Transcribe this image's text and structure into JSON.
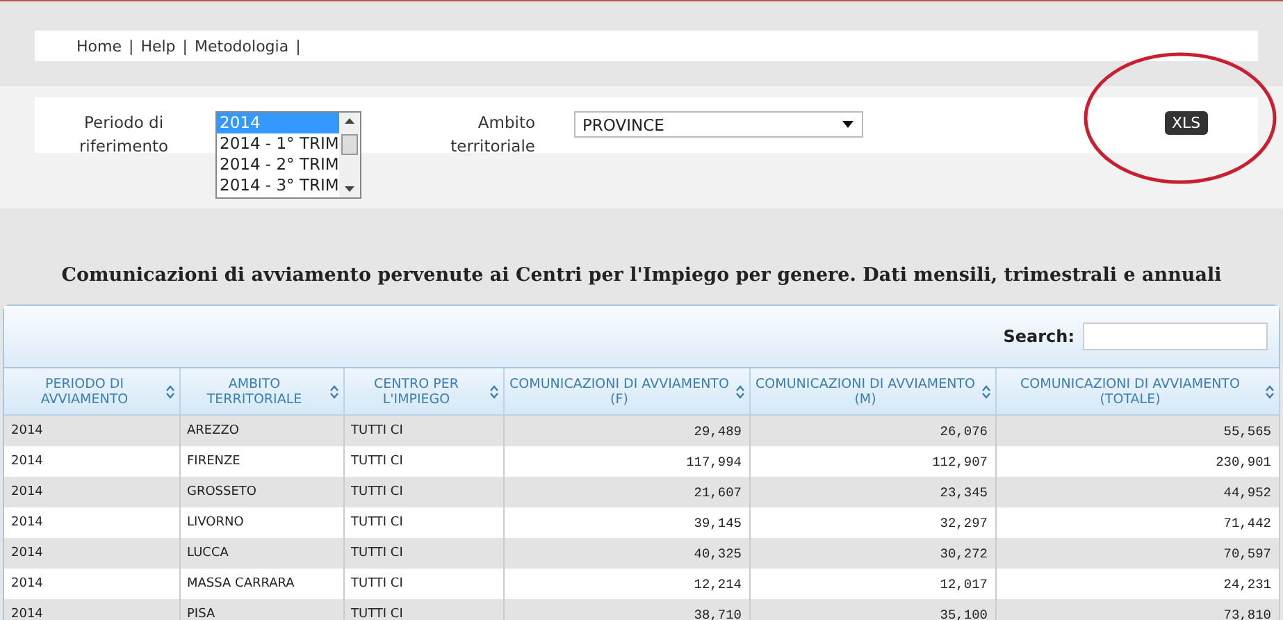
{
  "nav_links": [
    "Home",
    "Help",
    "Metodologia"
  ],
  "nav_separator": "|",
  "filters": {
    "period_label": "Periodo di riferimento",
    "period_options": [
      {
        "label": "2014",
        "selected": true
      },
      {
        "label": "2014 - 1° TRIM",
        "selected": false
      },
      {
        "label": "2014 - 2° TRIM",
        "selected": false
      },
      {
        "label": "2014 - 3° TRIM",
        "selected": false
      }
    ],
    "scope_label": "Ambito territoriale",
    "scope_value": "PROVINCE",
    "export_button": "XLS"
  },
  "title": "Comunicazioni di avviamento pervenute ai Centri per l'Impiego per genere. Dati mensili, trimestrali e annuali",
  "table": {
    "search_label": "Search:",
    "columns": [
      {
        "label": "PERIODO DI AVVIAMENTO",
        "kind": "text"
      },
      {
        "label": "AMBITO TERRITORIALE",
        "kind": "text"
      },
      {
        "label": "CENTRO PER L'IMPIEGO",
        "kind": "text"
      },
      {
        "label": "COMUNICAZIONI DI AVVIAMENTO (F)",
        "kind": "number"
      },
      {
        "label": "COMUNICAZIONI DI AVVIAMENTO (M)",
        "kind": "number"
      },
      {
        "label": "COMUNICAZIONI DI AVVIAMENTO (TOTALE)",
        "kind": "number"
      }
    ],
    "rows": [
      [
        "2014",
        "AREZZO",
        "TUTTI CI",
        "29,489",
        "26,076",
        "55,565"
      ],
      [
        "2014",
        "FIRENZE",
        "TUTTI CI",
        "117,994",
        "112,907",
        "230,901"
      ],
      [
        "2014",
        "GROSSETO",
        "TUTTI CI",
        "21,607",
        "23,345",
        "44,952"
      ],
      [
        "2014",
        "LIVORNO",
        "TUTTI CI",
        "39,145",
        "32,297",
        "71,442"
      ],
      [
        "2014",
        "LUCCA",
        "TUTTI CI",
        "40,325",
        "30,272",
        "70,597"
      ],
      [
        "2014",
        "MASSA CARRARA",
        "TUTTI CI",
        "12,214",
        "12,017",
        "24,231"
      ],
      [
        "2014",
        "PISA",
        "TUTTI CI",
        "38,710",
        "35,100",
        "73,810"
      ]
    ]
  }
}
